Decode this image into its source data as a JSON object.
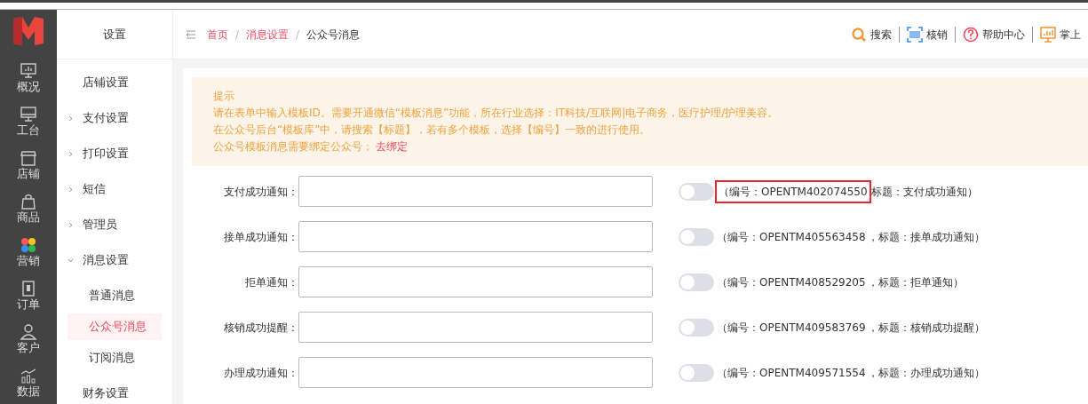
{
  "rail": [
    {
      "label": "概况"
    },
    {
      "label": "工台"
    },
    {
      "label": "店铺"
    },
    {
      "label": "商品"
    },
    {
      "label": "营销"
    },
    {
      "label": "订单"
    },
    {
      "label": "客户"
    },
    {
      "label": "数据"
    }
  ],
  "sidebar": {
    "title": "设置",
    "items": [
      {
        "label": "店铺设置",
        "expandable": false,
        "selected": false
      },
      {
        "label": "支付设置",
        "expandable": true,
        "expanded": false,
        "selected": false
      },
      {
        "label": "打印设置",
        "expandable": true,
        "expanded": false,
        "selected": false
      },
      {
        "label": "短信",
        "expandable": true,
        "expanded": false,
        "selected": false
      },
      {
        "label": "管理员",
        "expandable": true,
        "expanded": false,
        "selected": false
      },
      {
        "label": "消息设置",
        "expandable": true,
        "expanded": true,
        "selected": false,
        "children": [
          {
            "label": "普通消息",
            "selected": false
          },
          {
            "label": "公众号消息",
            "selected": true
          },
          {
            "label": "订阅消息",
            "selected": false
          }
        ]
      },
      {
        "label": "财务设置",
        "expandable": false,
        "selected": false
      }
    ]
  },
  "breadcrumb_separator": "/",
  "breadcrumb": [
    {
      "label": "首页",
      "link": true
    },
    {
      "label": "消息设置",
      "link": true
    },
    {
      "label": "公众号消息",
      "link": false
    }
  ],
  "toolbar": [
    {
      "label": "搜索"
    },
    {
      "label": "核销"
    },
    {
      "label": "帮助中心"
    },
    {
      "label": "掌上"
    }
  ],
  "notice": {
    "title": "提示",
    "lines": [
      "请在表单中输入模板ID。需要开通微信“模板消息”功能，所在行业选择：IT科技/互联网|电子商务，医疗护理/护理美容。",
      "在公众号后台“模板库”中，请搜索【标题】，若有多个模板，选择【编号】一致的进行使用。"
    ],
    "bind_text": "公众号模板消息需要绑定公众号；",
    "bind_link": "去绑定"
  },
  "templates": [
    {
      "label": "支付成功通知：",
      "on": false,
      "code_text": "（编号：OPENTM402074550",
      "title_text": "标题：支付成功通知）",
      "highlighted": true
    },
    {
      "label": "接单成功通知：",
      "on": false,
      "code_text": "（编号：OPENTM405563458",
      "title_text": "，标题：接单成功通知）",
      "highlighted": false
    },
    {
      "label": "拒单通知：",
      "on": false,
      "code_text": "（编号：OPENTM408529205",
      "title_text": "，标题：拒单通知）",
      "highlighted": false
    },
    {
      "label": "核销成功提醒：",
      "on": false,
      "code_text": "（编号：OPENTM409583769",
      "title_text": "，标题：核销成功提醒）",
      "highlighted": false
    },
    {
      "label": "办理成功通知：",
      "on": false,
      "code_text": "（编号：OPENTM409571554",
      "title_text": "，标题：办理成功通知）",
      "highlighted": false
    }
  ]
}
